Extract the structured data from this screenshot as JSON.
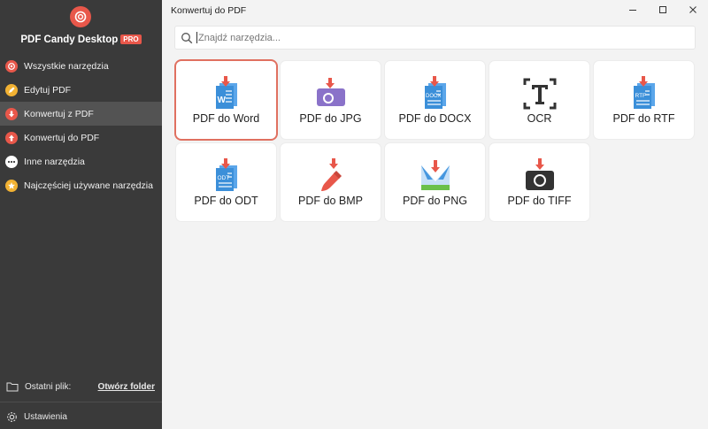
{
  "sidebar": {
    "app_title": "PDF Candy Desktop",
    "pro_badge": "PRO",
    "items": [
      {
        "label": "Wszystkie narzędzia",
        "icon": "target-icon",
        "color": "#e8574a"
      },
      {
        "label": "Edytuj PDF",
        "icon": "pencil-icon",
        "color": "#f2b233"
      },
      {
        "label": "Konwertuj z PDF",
        "icon": "arrow-down-icon",
        "color": "#e8574a",
        "active": true
      },
      {
        "label": "Konwertuj do PDF",
        "icon": "arrow-up-icon",
        "color": "#e8574a"
      },
      {
        "label": "Inne narzędzia",
        "icon": "more-icon",
        "color": "#ffffff"
      },
      {
        "label": "Najczęściej używane narzędzia",
        "icon": "star-icon",
        "color": "#f2b233"
      }
    ],
    "recent_label": "Ostatni plik:",
    "open_folder": "Otwórz folder",
    "settings": "Ustawienia"
  },
  "window": {
    "title": "Konwertuj do PDF"
  },
  "search": {
    "placeholder": "Znajdź narzędzia..."
  },
  "tools": [
    {
      "label": "PDF do Word",
      "icon": "word-file-icon",
      "selected": true
    },
    {
      "label": "PDF do JPG",
      "icon": "jpg-image-icon"
    },
    {
      "label": "PDF do DOCX",
      "icon": "docx-file-icon"
    },
    {
      "label": "OCR",
      "icon": "ocr-text-icon"
    },
    {
      "label": "PDF do RTF",
      "icon": "rtf-file-icon"
    },
    {
      "label": "PDF do ODT",
      "icon": "odt-file-icon"
    },
    {
      "label": "PDF do BMP",
      "icon": "paint-brush-icon"
    },
    {
      "label": "PDF do PNG",
      "icon": "png-image-icon"
    },
    {
      "label": "PDF do TIFF",
      "icon": "camera-icon"
    }
  ],
  "colors": {
    "accent": "#e8574a",
    "sidebar_bg": "#3a3a3a",
    "doc_blue": "#3b8fd9",
    "purple": "#8a72c9",
    "green": "#6ac04a"
  }
}
